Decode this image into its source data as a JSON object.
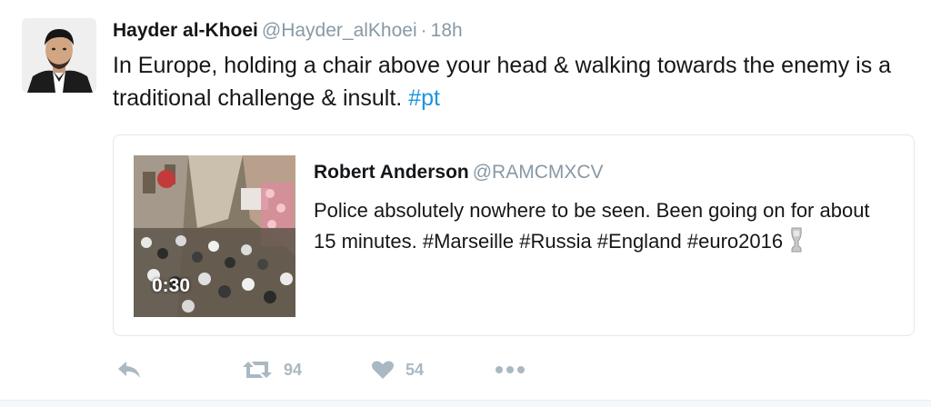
{
  "tweet": {
    "author": {
      "name": "Hayder al-Khoei",
      "handle": "@Hayder_alKhoei",
      "separator": "·",
      "time": "18h"
    },
    "text_main": "In Europe, holding a chair above your head & walking towards the enemy is a traditional challenge & insult. ",
    "hashtag": "#pt",
    "quoted": {
      "name": "Robert Anderson",
      "handle": "@RAMCMXCV",
      "text": "Police absolutely nowhere to be seen. Been going on for about 15 minutes. #Marseille #Russia #England #euro2016",
      "media": {
        "type": "video",
        "duration": "0:30"
      }
    },
    "actions": {
      "retweets": "94",
      "likes": "54"
    },
    "icons": {
      "reply": "reply-icon",
      "retweet": "retweet-icon",
      "like": "heart-icon",
      "more": "more-icon",
      "trophy": "trophy-icon"
    },
    "colors": {
      "link": "#1b95e0",
      "muted": "#8899a6",
      "action": "#aab8c2"
    }
  }
}
